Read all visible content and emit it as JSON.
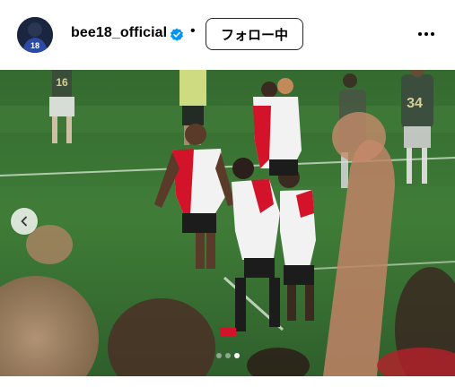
{
  "post_header": {
    "username": "bee18_official",
    "separator": "•",
    "follow_button_label": "フォロー中",
    "avatar_jersey_number": "18",
    "avatar_icon": "profile-avatar",
    "verified_icon": "verified-badge-icon",
    "more_icon": "more-options-icon"
  },
  "photo": {
    "alt_icon": "soccer-match-photo",
    "jersey_numbers_visible": [
      "16",
      "34"
    ],
    "prev_icon": "chevron-left-icon"
  },
  "carousel": {
    "total": 3,
    "active_index": 3
  },
  "colors": {
    "verified_blue": "#0095f6",
    "pitch_green": "#3f7a3a",
    "kit_red": "#d3132a",
    "kit_white": "#f2f2f2"
  }
}
